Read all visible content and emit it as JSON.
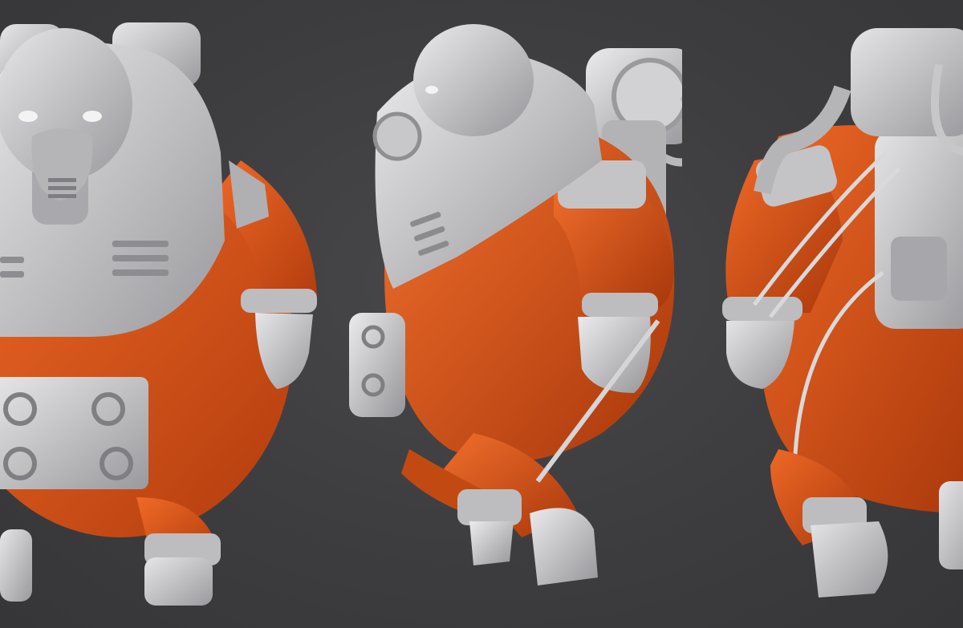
{
  "scene": {
    "background": "#3d3d3f",
    "suit_color": "#e2561b",
    "gear_color": "#c9c9cb",
    "views": [
      {
        "id": "front",
        "name": "front-view"
      },
      {
        "id": "side",
        "name": "side-view"
      },
      {
        "id": "back",
        "name": "three-quarter-back-view"
      }
    ]
  }
}
